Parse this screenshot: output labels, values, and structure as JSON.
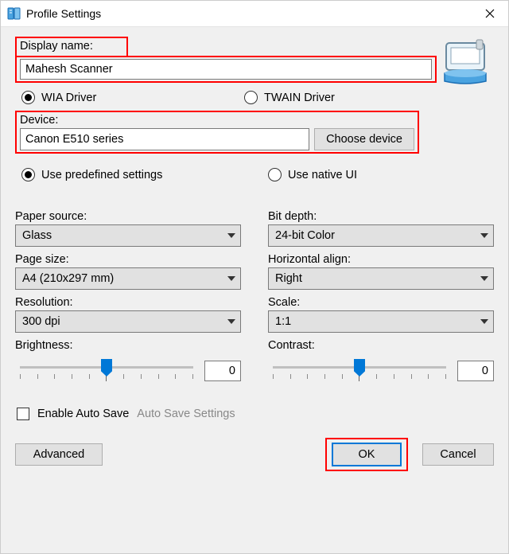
{
  "window": {
    "title": "Profile Settings"
  },
  "display_name": {
    "label": "Display name:",
    "value": "Mahesh Scanner"
  },
  "driver": {
    "options": [
      {
        "label": "WIA Driver",
        "checked": true
      },
      {
        "label": "TWAIN Driver",
        "checked": false
      }
    ]
  },
  "device": {
    "label": "Device:",
    "value": "Canon E510 series",
    "choose_label": "Choose device"
  },
  "settings_mode": {
    "options": [
      {
        "label": "Use predefined settings",
        "checked": true
      },
      {
        "label": "Use native UI",
        "checked": false
      }
    ]
  },
  "left_fields": {
    "paper_source": {
      "label": "Paper source:",
      "value": "Glass"
    },
    "page_size": {
      "label": "Page size:",
      "value": "A4 (210x297 mm)"
    },
    "resolution": {
      "label": "Resolution:",
      "value": "300 dpi"
    },
    "brightness": {
      "label": "Brightness:",
      "value": "0"
    }
  },
  "right_fields": {
    "bit_depth": {
      "label": "Bit depth:",
      "value": "24-bit Color"
    },
    "horizontal_align": {
      "label": "Horizontal align:",
      "value": "Right"
    },
    "scale": {
      "label": "Scale:",
      "value": "1:1"
    },
    "contrast": {
      "label": "Contrast:",
      "value": "0"
    }
  },
  "autosave": {
    "enable_label": "Enable Auto Save",
    "settings_label": "Auto Save Settings",
    "checked": false
  },
  "buttons": {
    "advanced": "Advanced",
    "ok": "OK",
    "cancel": "Cancel"
  }
}
